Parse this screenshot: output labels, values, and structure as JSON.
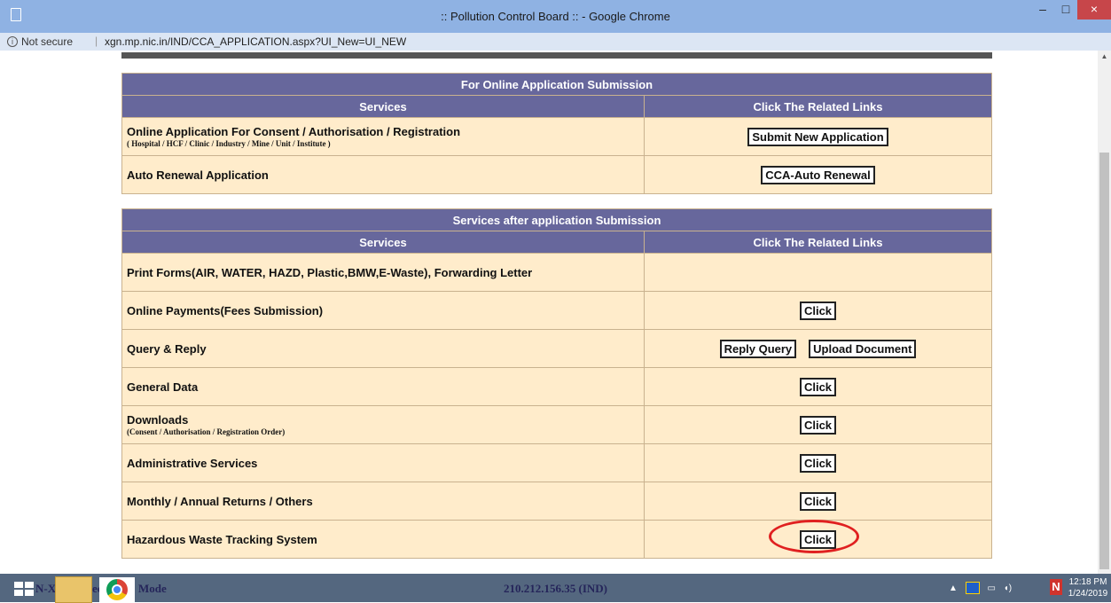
{
  "window": {
    "title": ":: Pollution Control Board :: - Google Chrome",
    "minimize": "–",
    "maximize": "□",
    "close": "×"
  },
  "address_bar": {
    "info_icon": "i",
    "security_label": "Not secure",
    "separator": "|",
    "url": "xgn.mp.nic.in/IND/CCA_APPLICATION.aspx?UI_New=UI_NEW"
  },
  "section1": {
    "title": "For Online Application Submission",
    "col_services": "Services",
    "col_links": "Click The Related Links",
    "rows": [
      {
        "label": "Online Application For Consent / Authorisation / Registration",
        "sublabel": "( Hospital / HCF / Clinic / Industry / Mine / Unit / Institute )",
        "buttons": [
          "Submit New Application"
        ]
      },
      {
        "label": "Auto Renewal Application",
        "sublabel": "",
        "buttons": [
          "CCA-Auto Renewal"
        ]
      }
    ]
  },
  "section2": {
    "title": "Services after application Submission",
    "col_services": "Services",
    "col_links": "Click The Related Links",
    "rows": [
      {
        "label": "Print Forms(AIR, WATER, HAZD, Plastic,BMW,E-Waste), Forwarding Letter",
        "sublabel": "",
        "buttons": []
      },
      {
        "label": "Online Payments(Fees Submission)",
        "sublabel": "",
        "buttons": [
          "Click"
        ]
      },
      {
        "label": "Query & Reply",
        "sublabel": "",
        "buttons": [
          "Reply Query",
          "Upload Document"
        ]
      },
      {
        "label": "General Data",
        "sublabel": "",
        "buttons": [
          "Click"
        ]
      },
      {
        "label": "Downloads",
        "sublabel": "(Consent / Authorisation / Registration Order)",
        "buttons": [
          "Click"
        ]
      },
      {
        "label": "Administrative Services",
        "sublabel": "",
        "buttons": [
          "Click"
        ]
      },
      {
        "label": "Monthly / Annual Returns / Others",
        "sublabel": "",
        "buttons": [
          "Click"
        ]
      },
      {
        "label": "Hazardous Waste Tracking System",
        "sublabel": "",
        "buttons": [
          "Click"
        ],
        "highlighted": true
      }
    ]
  },
  "taskbar": {
    "left_text": "N-Xt",
    "left_text2": "ed",
    "left_text3": "Mode",
    "center_text": "210.212.156.35 (IND)",
    "clock_time": "12:18 PM",
    "clock_date": "1/24/2019",
    "badge": "N"
  },
  "colors": {
    "header_bg": "#67679c",
    "row_bg": "#ffeccb",
    "highlight": "#e02020"
  }
}
